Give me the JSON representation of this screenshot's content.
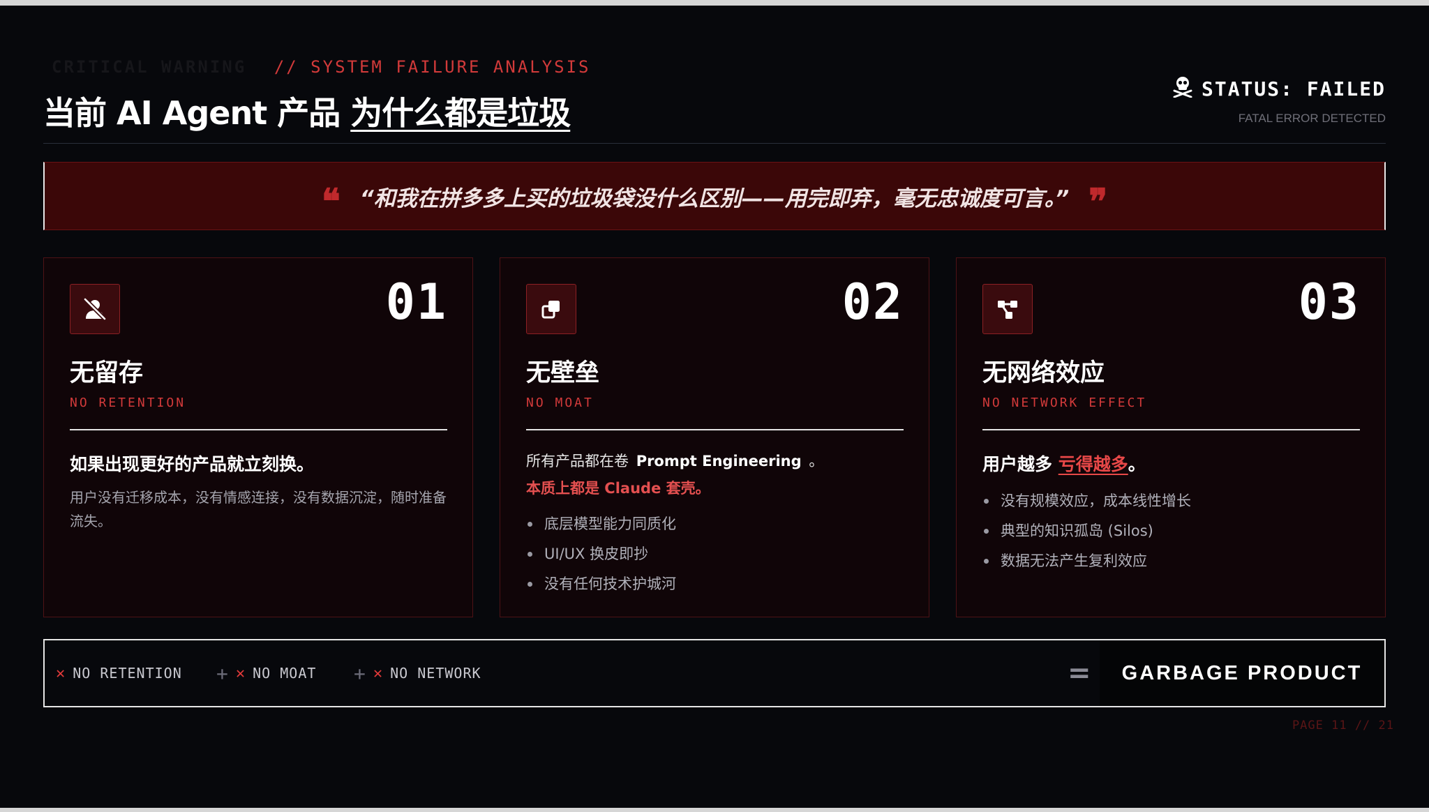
{
  "header": {
    "ghost_label": "CRITICAL WARNING",
    "section_label": "// SYSTEM FAILURE ANALYSIS",
    "title_main": "当前 AI Agent 产品 ",
    "title_highlight": "为什么都是垃圾",
    "status_text": "STATUS: FAILED",
    "status_icon": "skull-crossbones-icon",
    "status_sub": "FATAL ERROR DETECTED"
  },
  "quote": {
    "text": "“和我在拼多多上买的垃圾袋没什么区别——用完即弃，毫无忠诚度可言。”"
  },
  "cards": [
    {
      "icon": "user-slash-icon",
      "number": "01",
      "title": "无留存",
      "subtitle": "NO RETENTION",
      "lead": "如果出现更好的产品就立刻换。",
      "body": "用户没有迁移成本，没有情感连接，没有数据沉淀，随时准备流失。"
    },
    {
      "icon": "copy-icon",
      "number": "02",
      "title": "无壁垒",
      "subtitle": "NO MOAT",
      "lead_prefix": "所有产品都在卷",
      "lead_bold": "Prompt Engineering",
      "lead_suffix": "。",
      "accent": "本质上都是 Claude 套壳。",
      "bullets": [
        "底层模型能力同质化",
        "UI/UX 换皮即抄",
        "没有任何技术护城河"
      ]
    },
    {
      "icon": "network-nodes-icon",
      "number": "03",
      "title": "无网络效应",
      "subtitle": "NO NETWORK EFFECT",
      "lead_prefix": "用户越多 ",
      "lead_highlight": "亏得越多",
      "lead_suffix": "。",
      "bullets": [
        "没有规模效应，成本线性增长",
        "典型的知识孤岛 (Silos)",
        "数据无法产生复利效应"
      ]
    }
  ],
  "formula": {
    "items": [
      "NO RETENTION",
      "NO MOAT",
      "NO NETWORK"
    ],
    "operator_plus": "+",
    "operator_x": "✕",
    "equals": "=",
    "result": "GARBAGE PRODUCT"
  },
  "footer": {
    "page": "PAGE 11 // 21"
  },
  "colors": {
    "accent_red": "#d23a3a",
    "quote_bg": "#3b0708",
    "card_border": "#4e1216",
    "background": "#07080c"
  }
}
